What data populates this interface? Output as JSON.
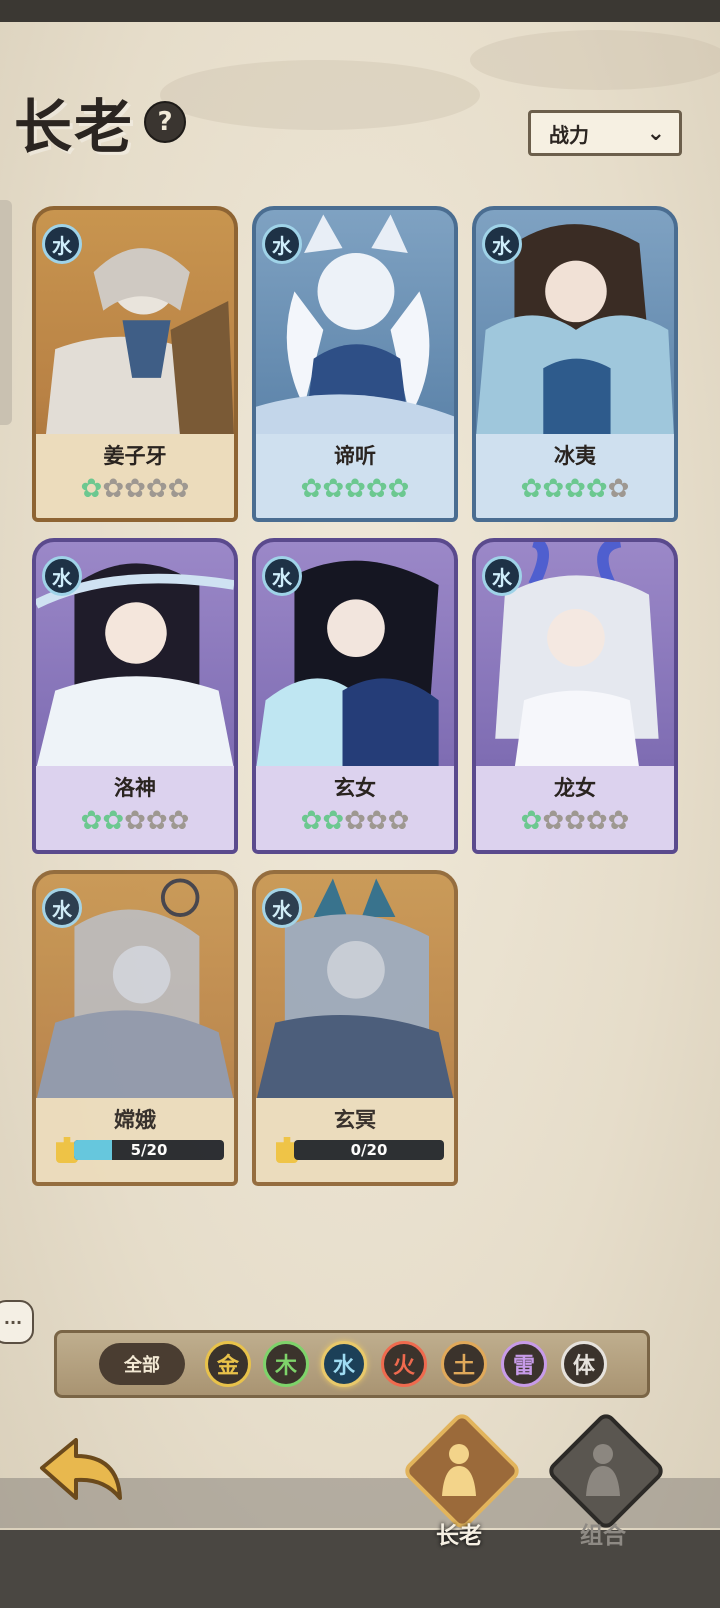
{
  "header": {
    "title": "长老",
    "help_glyph": "?",
    "sort_label": "战力"
  },
  "heroes": [
    {
      "name": "姜子牙",
      "element": "水",
      "frame": "gold",
      "stars_lit": 1,
      "stars_total": 5
    },
    {
      "name": "谛听",
      "element": "水",
      "frame": "blue",
      "stars_lit": 5,
      "stars_total": 5
    },
    {
      "name": "冰夷",
      "element": "水",
      "frame": "blue",
      "stars_lit": 4,
      "stars_total": 5
    },
    {
      "name": "洛神",
      "element": "水",
      "frame": "purple",
      "stars_lit": 2,
      "stars_total": 5
    },
    {
      "name": "玄女",
      "element": "水",
      "frame": "purple",
      "stars_lit": 2,
      "stars_total": 5
    },
    {
      "name": "龙女",
      "element": "水",
      "frame": "purple",
      "stars_lit": 1,
      "stars_total": 5
    }
  ],
  "locked_heroes": [
    {
      "name": "嫦娥",
      "element": "水",
      "fragments": "5/20",
      "progress": 0.25
    },
    {
      "name": "玄冥",
      "element": "水",
      "fragments": "0/20",
      "progress": 0
    }
  ],
  "filter": {
    "all_label": "全部",
    "elements": [
      {
        "label": "金",
        "color": "#e8c24a",
        "selected": false
      },
      {
        "label": "木",
        "color": "#7ed36a",
        "selected": false
      },
      {
        "label": "水",
        "color": "#9fdcf2",
        "selected": true
      },
      {
        "label": "火",
        "color": "#ef6a4e",
        "selected": false
      },
      {
        "label": "土",
        "color": "#e0a95a",
        "selected": false
      },
      {
        "label": "雷",
        "color": "#c79be8",
        "selected": false
      },
      {
        "label": "体",
        "color": "#e6e2dc",
        "selected": false
      }
    ]
  },
  "chat_bubble": "···",
  "nav": {
    "elders_label": "长老",
    "team_label": "组合"
  },
  "colors": {
    "star_on": "#6cc890",
    "star_off": "#9e9891",
    "accent_gold": "#e8c86a"
  }
}
